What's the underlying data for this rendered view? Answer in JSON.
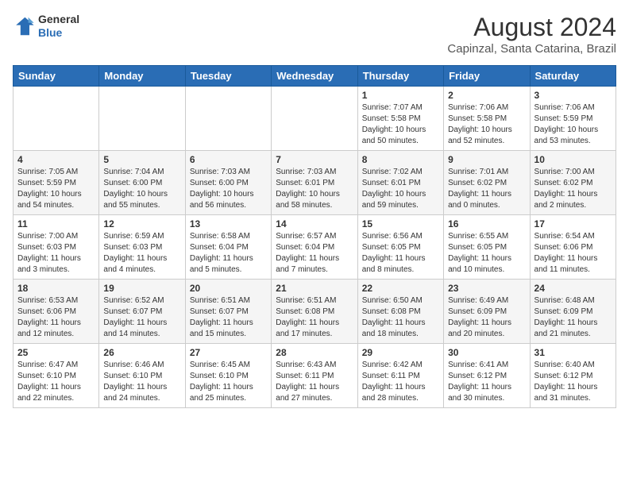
{
  "header": {
    "logo_line1": "General",
    "logo_line2": "Blue",
    "title": "August 2024",
    "subtitle": "Capinzal, Santa Catarina, Brazil"
  },
  "calendar": {
    "days_of_week": [
      "Sunday",
      "Monday",
      "Tuesday",
      "Wednesday",
      "Thursday",
      "Friday",
      "Saturday"
    ],
    "weeks": [
      [
        {
          "num": "",
          "info": ""
        },
        {
          "num": "",
          "info": ""
        },
        {
          "num": "",
          "info": ""
        },
        {
          "num": "",
          "info": ""
        },
        {
          "num": "1",
          "info": "Sunrise: 7:07 AM\nSunset: 5:58 PM\nDaylight: 10 hours\nand 50 minutes."
        },
        {
          "num": "2",
          "info": "Sunrise: 7:06 AM\nSunset: 5:58 PM\nDaylight: 10 hours\nand 52 minutes."
        },
        {
          "num": "3",
          "info": "Sunrise: 7:06 AM\nSunset: 5:59 PM\nDaylight: 10 hours\nand 53 minutes."
        }
      ],
      [
        {
          "num": "4",
          "info": "Sunrise: 7:05 AM\nSunset: 5:59 PM\nDaylight: 10 hours\nand 54 minutes."
        },
        {
          "num": "5",
          "info": "Sunrise: 7:04 AM\nSunset: 6:00 PM\nDaylight: 10 hours\nand 55 minutes."
        },
        {
          "num": "6",
          "info": "Sunrise: 7:03 AM\nSunset: 6:00 PM\nDaylight: 10 hours\nand 56 minutes."
        },
        {
          "num": "7",
          "info": "Sunrise: 7:03 AM\nSunset: 6:01 PM\nDaylight: 10 hours\nand 58 minutes."
        },
        {
          "num": "8",
          "info": "Sunrise: 7:02 AM\nSunset: 6:01 PM\nDaylight: 10 hours\nand 59 minutes."
        },
        {
          "num": "9",
          "info": "Sunrise: 7:01 AM\nSunset: 6:02 PM\nDaylight: 11 hours\nand 0 minutes."
        },
        {
          "num": "10",
          "info": "Sunrise: 7:00 AM\nSunset: 6:02 PM\nDaylight: 11 hours\nand 2 minutes."
        }
      ],
      [
        {
          "num": "11",
          "info": "Sunrise: 7:00 AM\nSunset: 6:03 PM\nDaylight: 11 hours\nand 3 minutes."
        },
        {
          "num": "12",
          "info": "Sunrise: 6:59 AM\nSunset: 6:03 PM\nDaylight: 11 hours\nand 4 minutes."
        },
        {
          "num": "13",
          "info": "Sunrise: 6:58 AM\nSunset: 6:04 PM\nDaylight: 11 hours\nand 5 minutes."
        },
        {
          "num": "14",
          "info": "Sunrise: 6:57 AM\nSunset: 6:04 PM\nDaylight: 11 hours\nand 7 minutes."
        },
        {
          "num": "15",
          "info": "Sunrise: 6:56 AM\nSunset: 6:05 PM\nDaylight: 11 hours\nand 8 minutes."
        },
        {
          "num": "16",
          "info": "Sunrise: 6:55 AM\nSunset: 6:05 PM\nDaylight: 11 hours\nand 10 minutes."
        },
        {
          "num": "17",
          "info": "Sunrise: 6:54 AM\nSunset: 6:06 PM\nDaylight: 11 hours\nand 11 minutes."
        }
      ],
      [
        {
          "num": "18",
          "info": "Sunrise: 6:53 AM\nSunset: 6:06 PM\nDaylight: 11 hours\nand 12 minutes."
        },
        {
          "num": "19",
          "info": "Sunrise: 6:52 AM\nSunset: 6:07 PM\nDaylight: 11 hours\nand 14 minutes."
        },
        {
          "num": "20",
          "info": "Sunrise: 6:51 AM\nSunset: 6:07 PM\nDaylight: 11 hours\nand 15 minutes."
        },
        {
          "num": "21",
          "info": "Sunrise: 6:51 AM\nSunset: 6:08 PM\nDaylight: 11 hours\nand 17 minutes."
        },
        {
          "num": "22",
          "info": "Sunrise: 6:50 AM\nSunset: 6:08 PM\nDaylight: 11 hours\nand 18 minutes."
        },
        {
          "num": "23",
          "info": "Sunrise: 6:49 AM\nSunset: 6:09 PM\nDaylight: 11 hours\nand 20 minutes."
        },
        {
          "num": "24",
          "info": "Sunrise: 6:48 AM\nSunset: 6:09 PM\nDaylight: 11 hours\nand 21 minutes."
        }
      ],
      [
        {
          "num": "25",
          "info": "Sunrise: 6:47 AM\nSunset: 6:10 PM\nDaylight: 11 hours\nand 22 minutes."
        },
        {
          "num": "26",
          "info": "Sunrise: 6:46 AM\nSunset: 6:10 PM\nDaylight: 11 hours\nand 24 minutes."
        },
        {
          "num": "27",
          "info": "Sunrise: 6:45 AM\nSunset: 6:10 PM\nDaylight: 11 hours\nand 25 minutes."
        },
        {
          "num": "28",
          "info": "Sunrise: 6:43 AM\nSunset: 6:11 PM\nDaylight: 11 hours\nand 27 minutes."
        },
        {
          "num": "29",
          "info": "Sunrise: 6:42 AM\nSunset: 6:11 PM\nDaylight: 11 hours\nand 28 minutes."
        },
        {
          "num": "30",
          "info": "Sunrise: 6:41 AM\nSunset: 6:12 PM\nDaylight: 11 hours\nand 30 minutes."
        },
        {
          "num": "31",
          "info": "Sunrise: 6:40 AM\nSunset: 6:12 PM\nDaylight: 11 hours\nand 31 minutes."
        }
      ]
    ]
  }
}
